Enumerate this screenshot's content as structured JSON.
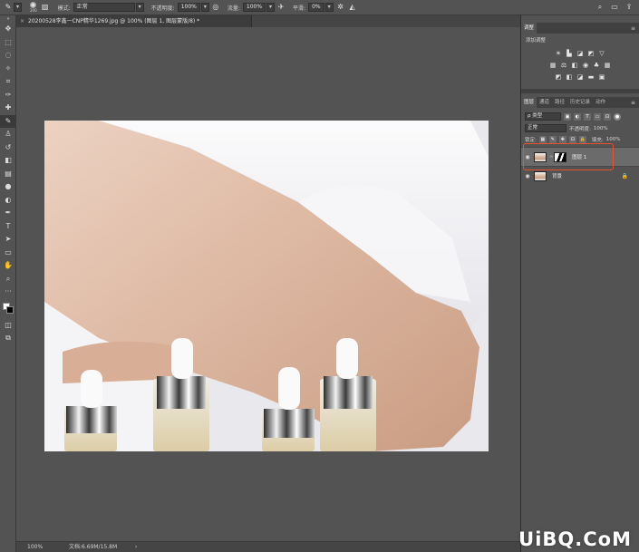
{
  "options_bar": {
    "brush_size": "200",
    "mode_label": "模式:",
    "mode_value": "正常",
    "opacity_label": "不透明度:",
    "opacity_value": "100%",
    "flow_label": "流量:",
    "flow_value": "100%",
    "smoothing_label": "平滑:",
    "smoothing_value": "0%"
  },
  "document": {
    "tab_title": "20200528李鑫一CNP精华1269.jpg @ 100% (图层 1, 图层蒙版/8) *",
    "close_glyph": "×"
  },
  "status_bar": {
    "zoom": "100%",
    "doc_size": "文档:6.69M/15.8M",
    "arrow": "›"
  },
  "adjustments_panel": {
    "tab": "调整",
    "add_label": "添加调整",
    "menu_glyph": "≡"
  },
  "layers_panel": {
    "tabs": [
      "图层",
      "通道",
      "路径",
      "历史记录",
      "动作"
    ],
    "filter_kind": "ρ 类型",
    "blend_mode": "正常",
    "opacity_label": "不透明度:",
    "opacity_value": "100%",
    "lock_label": "锁定:",
    "fill_label": "填充:",
    "fill_value": "100%",
    "layers": [
      {
        "name": "图层 1",
        "selected": true
      },
      {
        "name": "背景",
        "selected": false
      }
    ]
  },
  "watermark": "UiBQ.CoM",
  "colors": {
    "highlight_box": "#e8522a",
    "panel_bg": "#535353",
    "canvas_bg": "#e9e8ec"
  }
}
